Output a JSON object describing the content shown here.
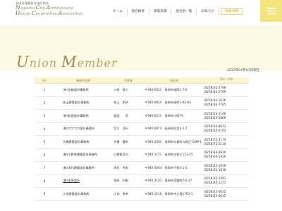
{
  "header": {
    "org_jp": "長岡市建築設計協同組合",
    "org_en_line1": "Nagaoka City Architectural",
    "org_en_line2": "Design Cooperative Association",
    "nav": [
      "ホーム",
      "組合概要",
      "建築実績",
      "組合員一覧",
      "お知らせ",
      "カレンダー"
    ],
    "member_button": "会員専用",
    "menu_icon": "hamburger-menu-icon"
  },
  "hero": {
    "title": "Union Member"
  },
  "content": {
    "date": "2022年04月01日現在",
    "columns": [
      "No",
      "事務所名称",
      "代表者",
      "所在地",
      "TEL・FAX"
    ],
    "rows": [
      {
        "no": "1",
        "name": "(有)金箱設計事務所",
        "rep": "小林　直人",
        "addr": "〒940-0021　長岡市城岡1-7-6",
        "tel": "(0258)32-2798",
        "fax": "(0258)32-2799"
      },
      {
        "no": "2",
        "name": "池上建築設計事務所",
        "rep": "池上　明子",
        "addr": "〒940-0824　長岡市高町1-93-63",
        "tel": "(0258)34-1619",
        "fax": "(0258)34-7785"
      },
      {
        "no": "3",
        "name": "(株)相田設計事務所",
        "rep": "相田　　武",
        "addr": "〒940-0211　長岡市小国79",
        "tel": "(0258)53-1148",
        "fax": "(0258)53-2866"
      },
      {
        "no": "4",
        "name": "(株)オオカワ設計事務所",
        "rep": "大川　注行",
        "addr": "〒940-0874　長岡市北宮4-2-7",
        "tel": "(0258)34-8653",
        "fax": "(0258)34-0703"
      },
      {
        "no": "5",
        "name": "大橋建築設計事務所",
        "rep": "大橋　龍幸",
        "addr": "〒940-2402　長岡市与板町与板乙1298-1",
        "tel": "(0258)72-3174",
        "fax": "(0258)72-2110"
      },
      {
        "no": "6",
        "name": "(株)小野塚建築設計事務所",
        "rep": "小野塚武久",
        "addr": "〒940-1151　長岡市三和3-123-15",
        "tel": "(0258)34-4920",
        "fax": "(0258)34-1426"
      },
      {
        "no": "7",
        "name": "(株)木村建築設計事務所",
        "rep": "木村　名前",
        "addr": "〒940-0064　長岡市千秋4-1-5",
        "tel": "(0258)32-1839",
        "fax": "(0258)32-1838"
      },
      {
        "no": "8",
        "name": "(株)里原設計",
        "rep": "里原　利昭",
        "addr": "〒940-2103　長岡市宮路町2-6-17",
        "tel": "(0258)35-1291",
        "fax": "(0258)35-1271",
        "is_link": true
      },
      {
        "no": "9",
        "name": "小池建築設計事務所",
        "rep": "小池　孝幸",
        "addr": "〒940-1146　長岡市中之島1763-1",
        "tel": "(0258)22-0635",
        "fax": "(0258)22-0635"
      }
    ]
  },
  "colors": {
    "accent": "#f3e57c",
    "hero_bg": "#fcf9e4",
    "table_head": "#fdf4cf"
  }
}
